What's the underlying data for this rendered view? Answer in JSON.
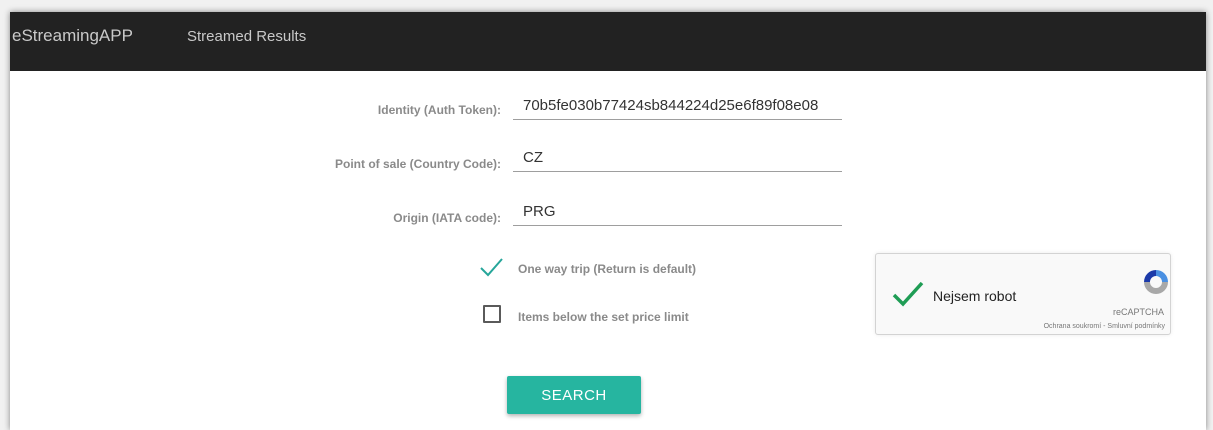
{
  "navbar": {
    "brand": "eStreamingAPP",
    "link": "Streamed Results"
  },
  "form": {
    "identity": {
      "label": "Identity (Auth Token):",
      "value": "70b5fe030b77424sb844224d25e6f89f08e08"
    },
    "pos": {
      "label": "Point of sale (Country Code):",
      "value": "CZ"
    },
    "origin": {
      "label": "Origin (IATA code):",
      "value": "PRG"
    },
    "one_way": {
      "label": "One way trip (Return is default)",
      "checked": true
    },
    "price_limit": {
      "label": "Items below the set price limit",
      "checked": false
    },
    "search_label": "SEARCH"
  },
  "recaptcha": {
    "text": "Nejsem robot",
    "brand": "reCAPTCHA",
    "links": "Ochrana soukromí - Smluvní podmínky"
  },
  "colors": {
    "navbar": "#222222",
    "accent": "#26b5a0",
    "check_teal": "#26a69a",
    "recaptcha_check": "#1f9d55"
  }
}
